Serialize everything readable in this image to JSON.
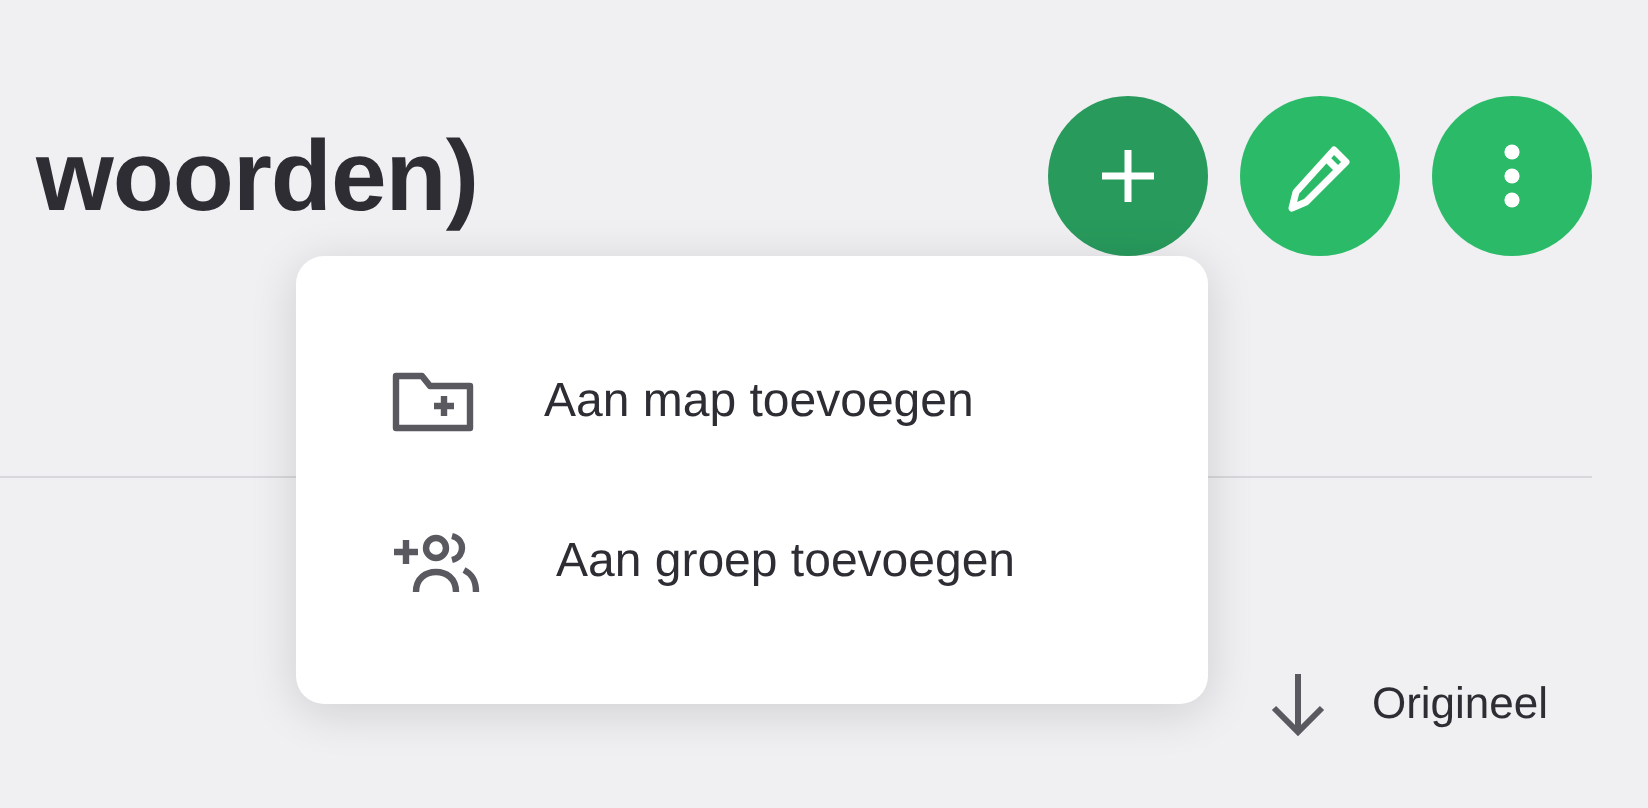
{
  "title": "woorden)",
  "actions": [
    {
      "kind": "add",
      "selected": true
    },
    {
      "kind": "edit",
      "selected": false
    },
    {
      "kind": "more",
      "selected": false
    }
  ],
  "menu": {
    "open": true,
    "items": [
      {
        "kind": "folder",
        "label": "Aan map toevoegen"
      },
      {
        "kind": "group",
        "label": "Aan groep toevoegen"
      }
    ]
  },
  "sort": {
    "label": "Origineel"
  }
}
